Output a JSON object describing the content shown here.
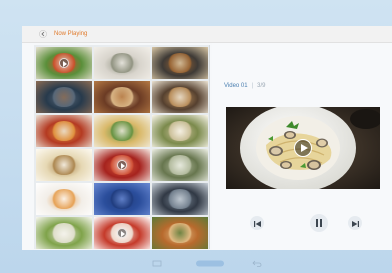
{
  "header": {
    "title": "Now Playing"
  },
  "video": {
    "name": "Video 01",
    "position": "3/9"
  },
  "playback": {
    "volume_fraction": 0.25
  },
  "thumbnails": [
    {
      "c1": "#5a8f3a",
      "c2": "#d64a2a",
      "c3": "#e8e1d2"
    },
    {
      "c1": "#d8d4cc",
      "c2": "#8a8d7a",
      "c3": "#f2efe9"
    },
    {
      "c1": "#3e3a36",
      "c2": "#a06834",
      "c3": "#d9c7a6"
    },
    {
      "c1": "#273a4c",
      "c2": "#5d6d7e",
      "c3": "#8c6c54"
    },
    {
      "c1": "#6b3b24",
      "c2": "#e3c08e",
      "c3": "#b57a45"
    },
    {
      "c1": "#55402f",
      "c2": "#c49761",
      "c3": "#ece3d2"
    },
    {
      "c1": "#b43a22",
      "c2": "#e49a41",
      "c3": "#ebe5d9"
    },
    {
      "c1": "#d9b96a",
      "c2": "#5c8f3e",
      "c3": "#f3eee2"
    },
    {
      "c1": "#7b8a4c",
      "c2": "#d4c6a2",
      "c3": "#fbf7ee"
    },
    {
      "c1": "#e6d8b4",
      "c2": "#a77f46",
      "c3": "#fdfaf2"
    },
    {
      "c1": "#a6231e",
      "c2": "#d65a3d",
      "c3": "#f5e9e3"
    },
    {
      "c1": "#67764e",
      "c2": "#bcc3a8",
      "c3": "#eef0e6"
    },
    {
      "c1": "#f2eee8",
      "c2": "#e59a47",
      "c3": "#ffffff"
    },
    {
      "c1": "#2b4e9c",
      "c2": "#1f3b7c",
      "c3": "#6a8ad4"
    },
    {
      "c1": "#313945",
      "c2": "#7c8a98",
      "c3": "#c9d1d9"
    },
    {
      "c1": "#7fa34a",
      "c2": "#e8e4d8",
      "c3": "#f7f6f0"
    },
    {
      "c1": "#c53a2a",
      "c2": "#f1e8dc",
      "c3": "#ffffff"
    },
    {
      "c1": "#b86a2d",
      "c2": "#e5c089",
      "c3": "#5b7a38"
    }
  ],
  "colors": {
    "accent": "#e07a2b",
    "link": "#4a7fb0",
    "device": "#c8ddee"
  },
  "icons": {
    "back": "chevron-left-icon",
    "prev": "skip-previous-icon",
    "pause": "pause-icon",
    "next": "skip-next-icon",
    "volume": "volume-icon",
    "nav_home": "home-button-icon",
    "nav_recent": "recent-apps-icon",
    "nav_back": "nav-back-icon"
  }
}
